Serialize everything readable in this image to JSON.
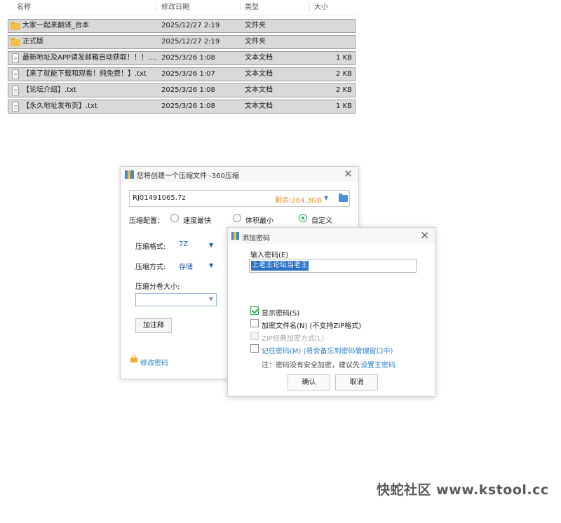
{
  "file_list": {
    "columns": {
      "name": "名称",
      "modified": "修改日期",
      "type": "类型",
      "size": "大小",
      "sort_indicator": "^"
    },
    "rows": [
      {
        "icon": "folder-icon",
        "name": "大家一起来翻译_台本",
        "modified": "2025/12/27 2:19",
        "type": "文件夹",
        "size": ""
      },
      {
        "icon": "folder-icon",
        "name": "正式版",
        "modified": "2025/12/27 2:19",
        "type": "文件夹",
        "size": ""
      },
      {
        "icon": "text-file-icon",
        "name": "最新地址及APP请发邮箱自动获取！！！....",
        "modified": "2025/3/26 1:08",
        "type": "文本文档",
        "size": "1 KB"
      },
      {
        "icon": "text-file-icon",
        "name": "【来了就能下载和观看！纯免费！】.txt",
        "modified": "2025/3/26 1:07",
        "type": "文本文档",
        "size": "2 KB"
      },
      {
        "icon": "text-file-icon",
        "name": "【论坛介绍】.txt",
        "modified": "2025/3/26 1:08",
        "type": "文本文档",
        "size": "2 KB"
      },
      {
        "icon": "text-file-icon",
        "name": "【永久地址发布页】.txt",
        "modified": "2025/3/26 1:08",
        "type": "文本文档",
        "size": "1 KB"
      }
    ]
  },
  "zip_dialog": {
    "title": "您将创建一个压缩文件 -360压缩",
    "close": "✕",
    "archive_path": "RJ01491065.7z",
    "free_space": "剩余:264.3GB",
    "config_label": "压缩配置：",
    "config_options": [
      "速度最快",
      "体积最小",
      "自定义"
    ],
    "config_selected": "自定义",
    "format_label": "压缩格式:",
    "format_value": "7Z",
    "method_label": "压缩方式:",
    "method_value": "存储",
    "volume_label": "压缩分卷大小:",
    "volume_value": "",
    "comment_button": "加注释",
    "change_password": "修改密码"
  },
  "password_dialog": {
    "title": "添加密码",
    "close": "✕",
    "enter_label": "输入密码(E)",
    "password_value": "上老王论坛当老王",
    "options": [
      {
        "label": "显示密码(S)",
        "checked": true,
        "enabled": true
      },
      {
        "label": "加密文件名(N) (不支持ZIP格式)",
        "checked": false,
        "enabled": true
      },
      {
        "label": "ZIP经典加密方式(L)",
        "checked": false,
        "enabled": false
      },
      {
        "label": "记住密码(M) (将会备忘到密码管理窗口中)",
        "checked": false,
        "enabled": true
      }
    ],
    "note": "注：密码没有安全加密，建议先",
    "note_link": "设置主密码",
    "ok_button": "确认",
    "cancel_button": "取消"
  },
  "watermark": "快蛇社区 www.kstool.cc",
  "colors": {
    "selection_bg": "#d9d9d9",
    "accent_blue": "#2a7fd4",
    "accent_green": "#2eaa55",
    "free_space_orange": "#f08a1c",
    "folder_yellow": "#f4c04a"
  }
}
